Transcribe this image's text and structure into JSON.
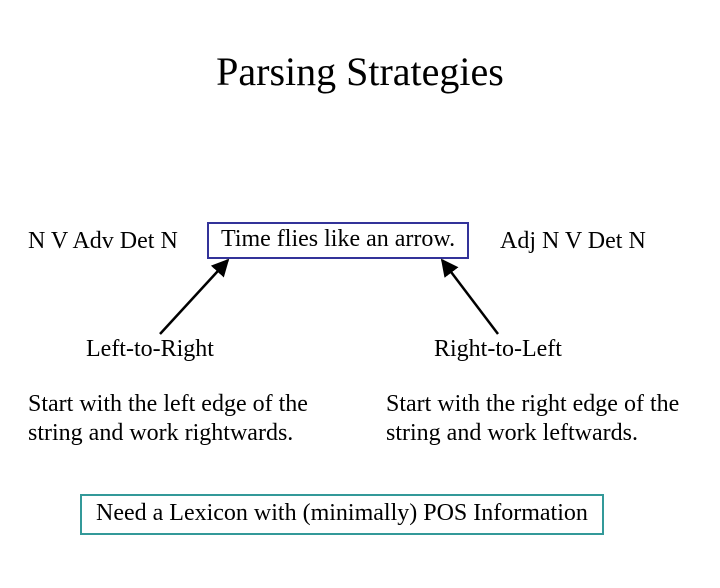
{
  "title": "Parsing Strategies",
  "pos_left": "N V Adv Det N",
  "sentence": "Time flies like an arrow.",
  "pos_right": "Adj N V Det N",
  "label_ltr": "Left-to-Right",
  "label_rtl": "Right-to-Left",
  "desc_left": "Start with the left edge of the string and work rightwards.",
  "desc_right": "Start with the right edge of the string and work leftwards.",
  "lexicon": "Need a Lexicon with (minimally) POS Information",
  "colors": {
    "sentence_border": "#333399",
    "lexicon_border": "#339999"
  }
}
